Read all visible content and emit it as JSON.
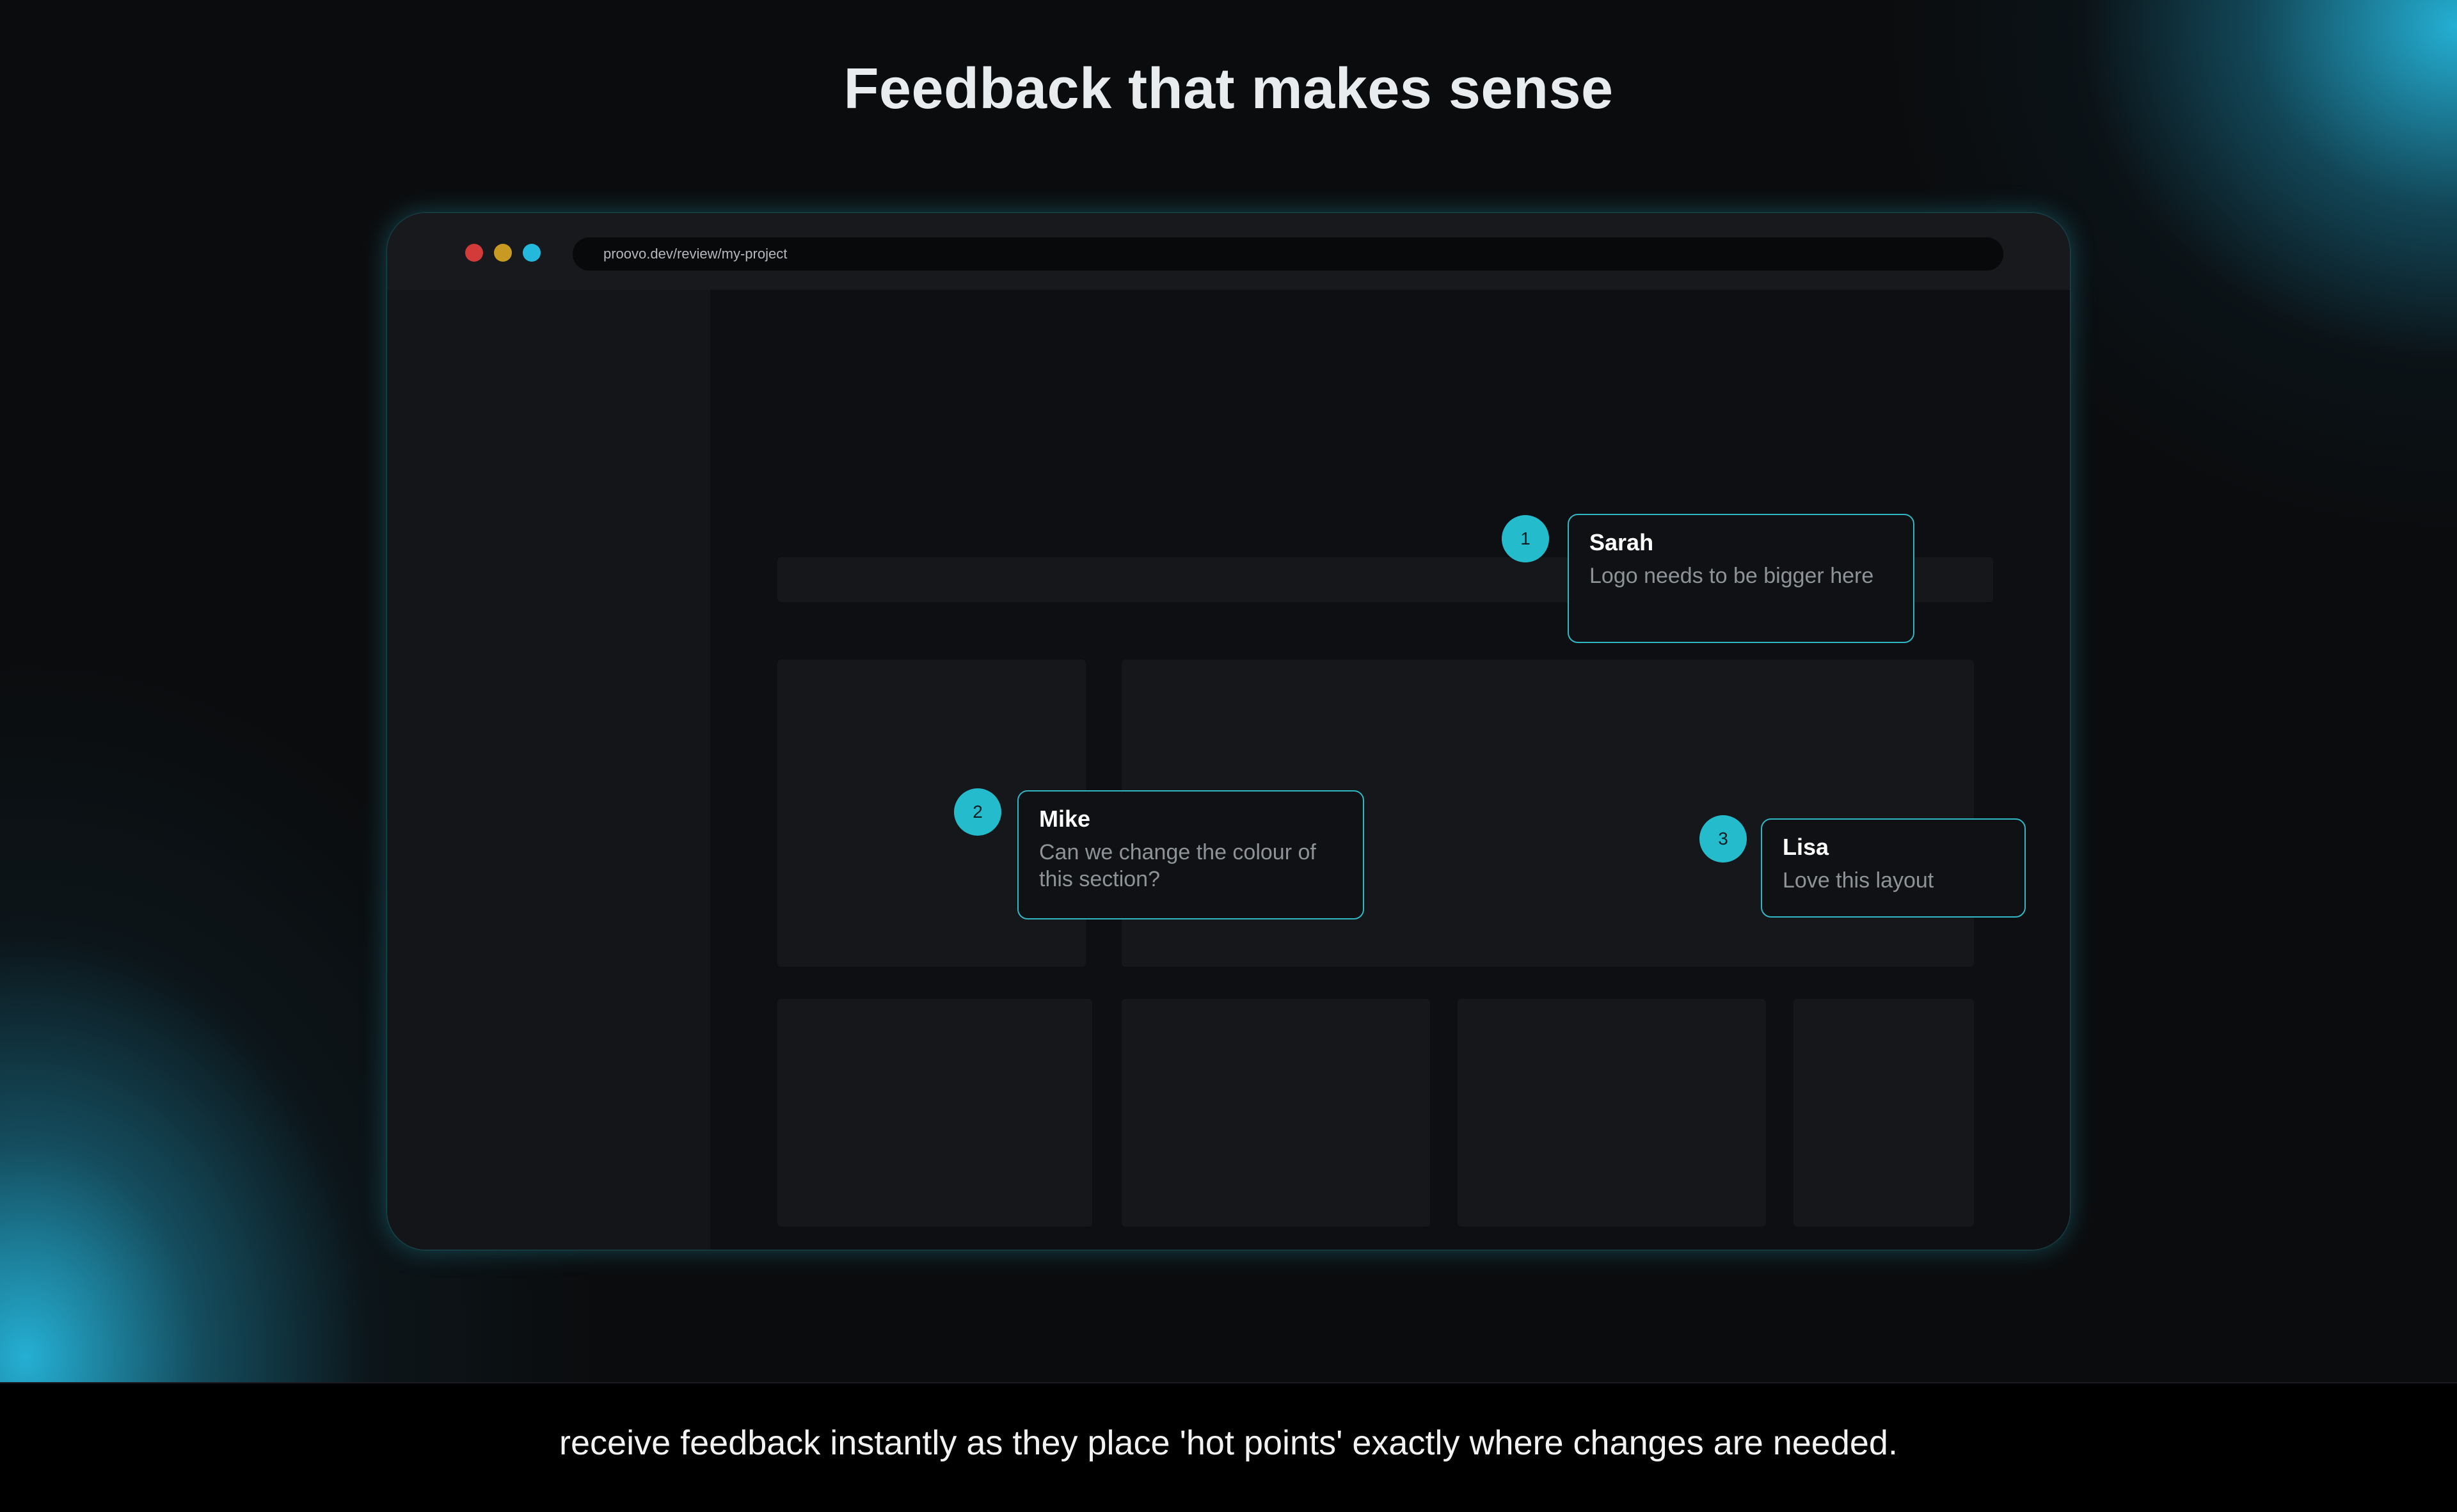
{
  "headline": "Feedback that makes sense",
  "browser": {
    "url": "proovo.dev/review/my-project",
    "traffic_lights": [
      "#d33a3a",
      "#c89a22",
      "#23b8dc"
    ]
  },
  "comments": [
    {
      "number": "1",
      "name": "Sarah",
      "text": "Logo needs to be bigger here"
    },
    {
      "number": "2",
      "name": "Mike",
      "text": "Can we change the colour of this section?"
    },
    {
      "number": "3",
      "name": "Lisa",
      "text": "Love this layout"
    }
  ],
  "caption": "receive feedback instantly as they place 'hot points' exactly where changes are needed.",
  "colors": {
    "accent": "#24bccd",
    "background": "#0b0c0e",
    "card_border": "#2fb8c4"
  }
}
